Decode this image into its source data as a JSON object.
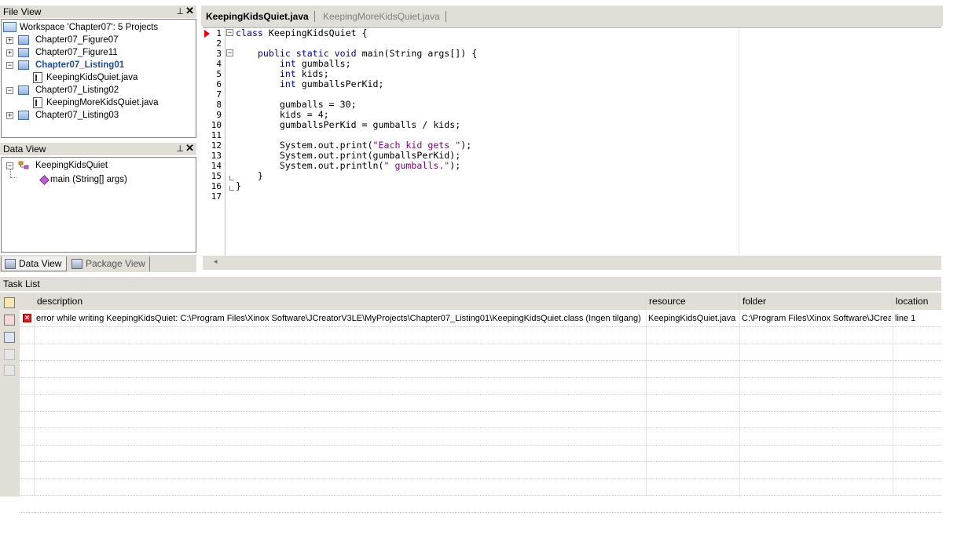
{
  "file_view": {
    "title": "File View",
    "pin_glyph": "⊥",
    "close_glyph": "✕",
    "workspace": "Workspace 'Chapter07': 5 Projects",
    "items": [
      {
        "label": "Chapter07_Figure07",
        "type": "project",
        "expander": "+"
      },
      {
        "label": "Chapter07_Figure11",
        "type": "project",
        "expander": "+"
      },
      {
        "label": "Chapter07_Listing01",
        "type": "project",
        "expander": "−",
        "active": true
      },
      {
        "label": "KeepingKidsQuiet.java",
        "type": "file"
      },
      {
        "label": "Chapter07_Listing02",
        "type": "project",
        "expander": "−"
      },
      {
        "label": "KeepingMoreKidsQuiet.java",
        "type": "file"
      },
      {
        "label": "Chapter07_Listing03",
        "type": "project",
        "expander": "+"
      }
    ]
  },
  "data_view": {
    "title": "Data View",
    "class_label": "KeepingKidsQuiet",
    "method_label": "main (String[] args)",
    "tabs": [
      "Data View",
      "Package View"
    ]
  },
  "editor": {
    "tabs": [
      "KeepingKidsQuiet.java",
      "KeepingMoreKidsQuiet.java"
    ],
    "line_numbers": [
      "1",
      "2",
      "3",
      "4",
      "5",
      "6",
      "7",
      "8",
      "9",
      "10",
      "11",
      "12",
      "13",
      "14",
      "15",
      "16",
      "17"
    ],
    "lines": [
      "class KeepingKidsQuiet {",
      "",
      "    public static void main(String args[]) {",
      "        int gumballs;",
      "        int kids;",
      "        int gumballsPerKid;",
      "",
      "        gumballs = 30;",
      "        kids = 4;",
      "        gumballsPerKid = gumballs / kids;",
      "",
      "        System.out.print(\"Each kid gets \");",
      "        System.out.print(gumballsPerKid);",
      "        System.out.println(\" gumballs.\");",
      "    }",
      "}",
      ""
    ]
  },
  "task_list": {
    "title": "Task List",
    "columns": [
      "description",
      "resource",
      "folder",
      "location"
    ],
    "rows": [
      {
        "description": "error while writing KeepingKidsQuiet: C:\\Program Files\\Xinox Software\\JCreatorV3LE\\MyProjects\\Chapter07_Listing01\\KeepingKidsQuiet.class (Ingen tilgang)",
        "resource": "KeepingKidsQuiet.java",
        "folder": "C:\\Program Files\\Xinox Software\\JCreat",
        "location": "line 1",
        "status_icon": "error-icon"
      }
    ]
  },
  "colors": {
    "panel_bg": "#d4d0c8",
    "keyword": "#0000a0",
    "string": "#800080",
    "active_project": "#1f4ea0",
    "error": "#e02020"
  }
}
